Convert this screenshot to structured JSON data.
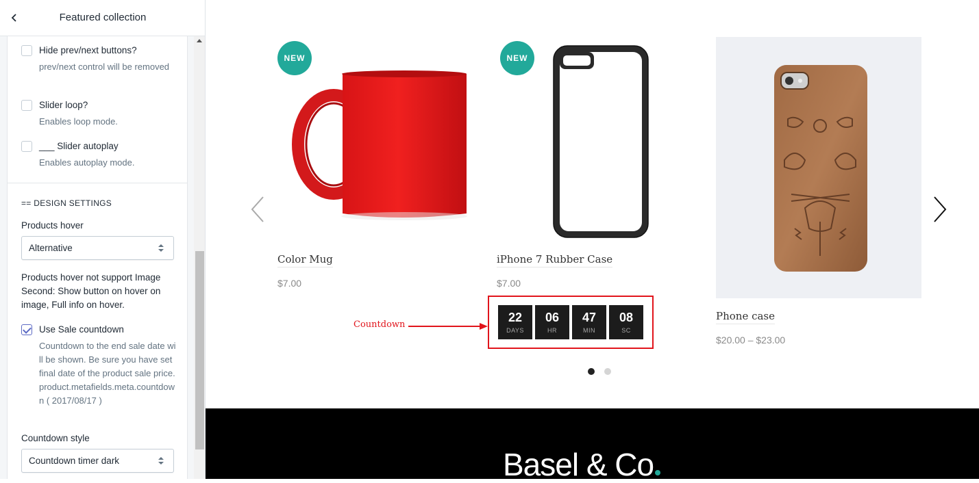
{
  "panel": {
    "title": "Featured collection",
    "settings": {
      "hide_prev_next": {
        "label": "Hide prev/next buttons?",
        "help": "prev/next control will be removed",
        "checked": false
      },
      "slider_loop": {
        "label": "Slider loop?",
        "help": "Enables loop mode.",
        "checked": false
      },
      "slider_autoplay": {
        "label": "___ Slider autoplay",
        "help": "Enables autoplay mode.",
        "checked": false
      },
      "design_heading": "== DESIGN SETTINGS",
      "products_hover": {
        "label": "Products hover",
        "value": "Alternative"
      },
      "hover_note": "Products hover not support Image Second: Show button on hover on image, Full info on hover.",
      "sale_countdown": {
        "label": "Use Sale countdown",
        "help": "Countdown to the end sale date will be shown. Be sure you have set final date of the product sale price. product.metafields.meta.countdown ( 2017/08/17 )",
        "checked": true
      },
      "countdown_style": {
        "label": "Countdown style",
        "value": "Countdown timer dark"
      }
    }
  },
  "preview": {
    "products": [
      {
        "title": "Color Mug",
        "price": "$7.00",
        "badge": "NEW"
      },
      {
        "title": "iPhone 7 Rubber Case",
        "price": "$7.00",
        "badge": "NEW"
      },
      {
        "title": "Phone case",
        "price": "$20.00 – $23.00",
        "badge": ""
      }
    ],
    "countdown": {
      "days": "22",
      "days_label": "DAYS",
      "hours": "06",
      "hours_label": "HR",
      "minutes": "47",
      "minutes_label": "MIN",
      "seconds": "08",
      "seconds_label": "SC"
    },
    "annotation": "Countdown",
    "pagination": {
      "pages": 2,
      "active": 1
    },
    "footer": {
      "brand": "Basel & Co"
    }
  },
  "colors": {
    "accent_teal": "#22a99a",
    "annotation_red": "#e1141b",
    "countdown_bg": "#1c1c1c",
    "checkbox_accent": "#5c6ac4"
  },
  "icons": [
    "back-chevron-icon",
    "prev-arrow-icon",
    "next-arrow-icon",
    "select-caret-icon",
    "collapse-arrow-icon"
  ]
}
